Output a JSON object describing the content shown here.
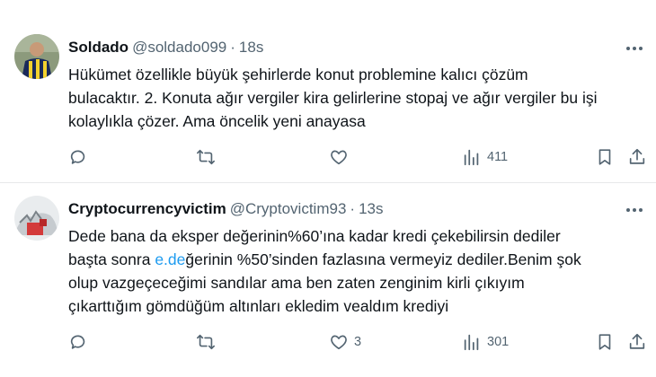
{
  "tweets": [
    {
      "name": "Soldado",
      "handle": "@soldado099",
      "dot": "·",
      "time": "18s",
      "lines": [
        "Hükümet özellikle büyük şehirlerde konut problemine kalıcı çözüm",
        "bulacaktır. 2. Konuta ağır vergiler kira gelirlerine stopaj ve ağır vergiler bu işi",
        "kolaylıkla çözer. Ama öncelik yeni anayasa"
      ],
      "likes": "",
      "views": "411",
      "icons": [
        "reply-icon",
        "retweet-icon",
        "like-icon",
        "views-icon",
        "bookmark-icon",
        "share-icon",
        "more-icon"
      ]
    },
    {
      "name": "Cryptocurrencyvictim",
      "handle": "@Cryptovictim93",
      "dot": "·",
      "time": "13s",
      "line1": "Dede bana da eksper değerinin%60’ına kadar kredi çekebilirsin dediler",
      "line2_pre": "başta sonra ",
      "line2_link": "e.de",
      "line2_post": "ğerinin %50’sinden fazlasına vermeyiz dediler.Benim şok",
      "line3": "olup vazgeçeceğimi sandılar ama ben zaten zenginim kirli çıkıyım",
      "line4": "çıkarttığım gömdüğüm altınları ekledim vealdım krediyi",
      "likes": "3",
      "views": "301",
      "link_color": "#1d9bf0"
    }
  ]
}
